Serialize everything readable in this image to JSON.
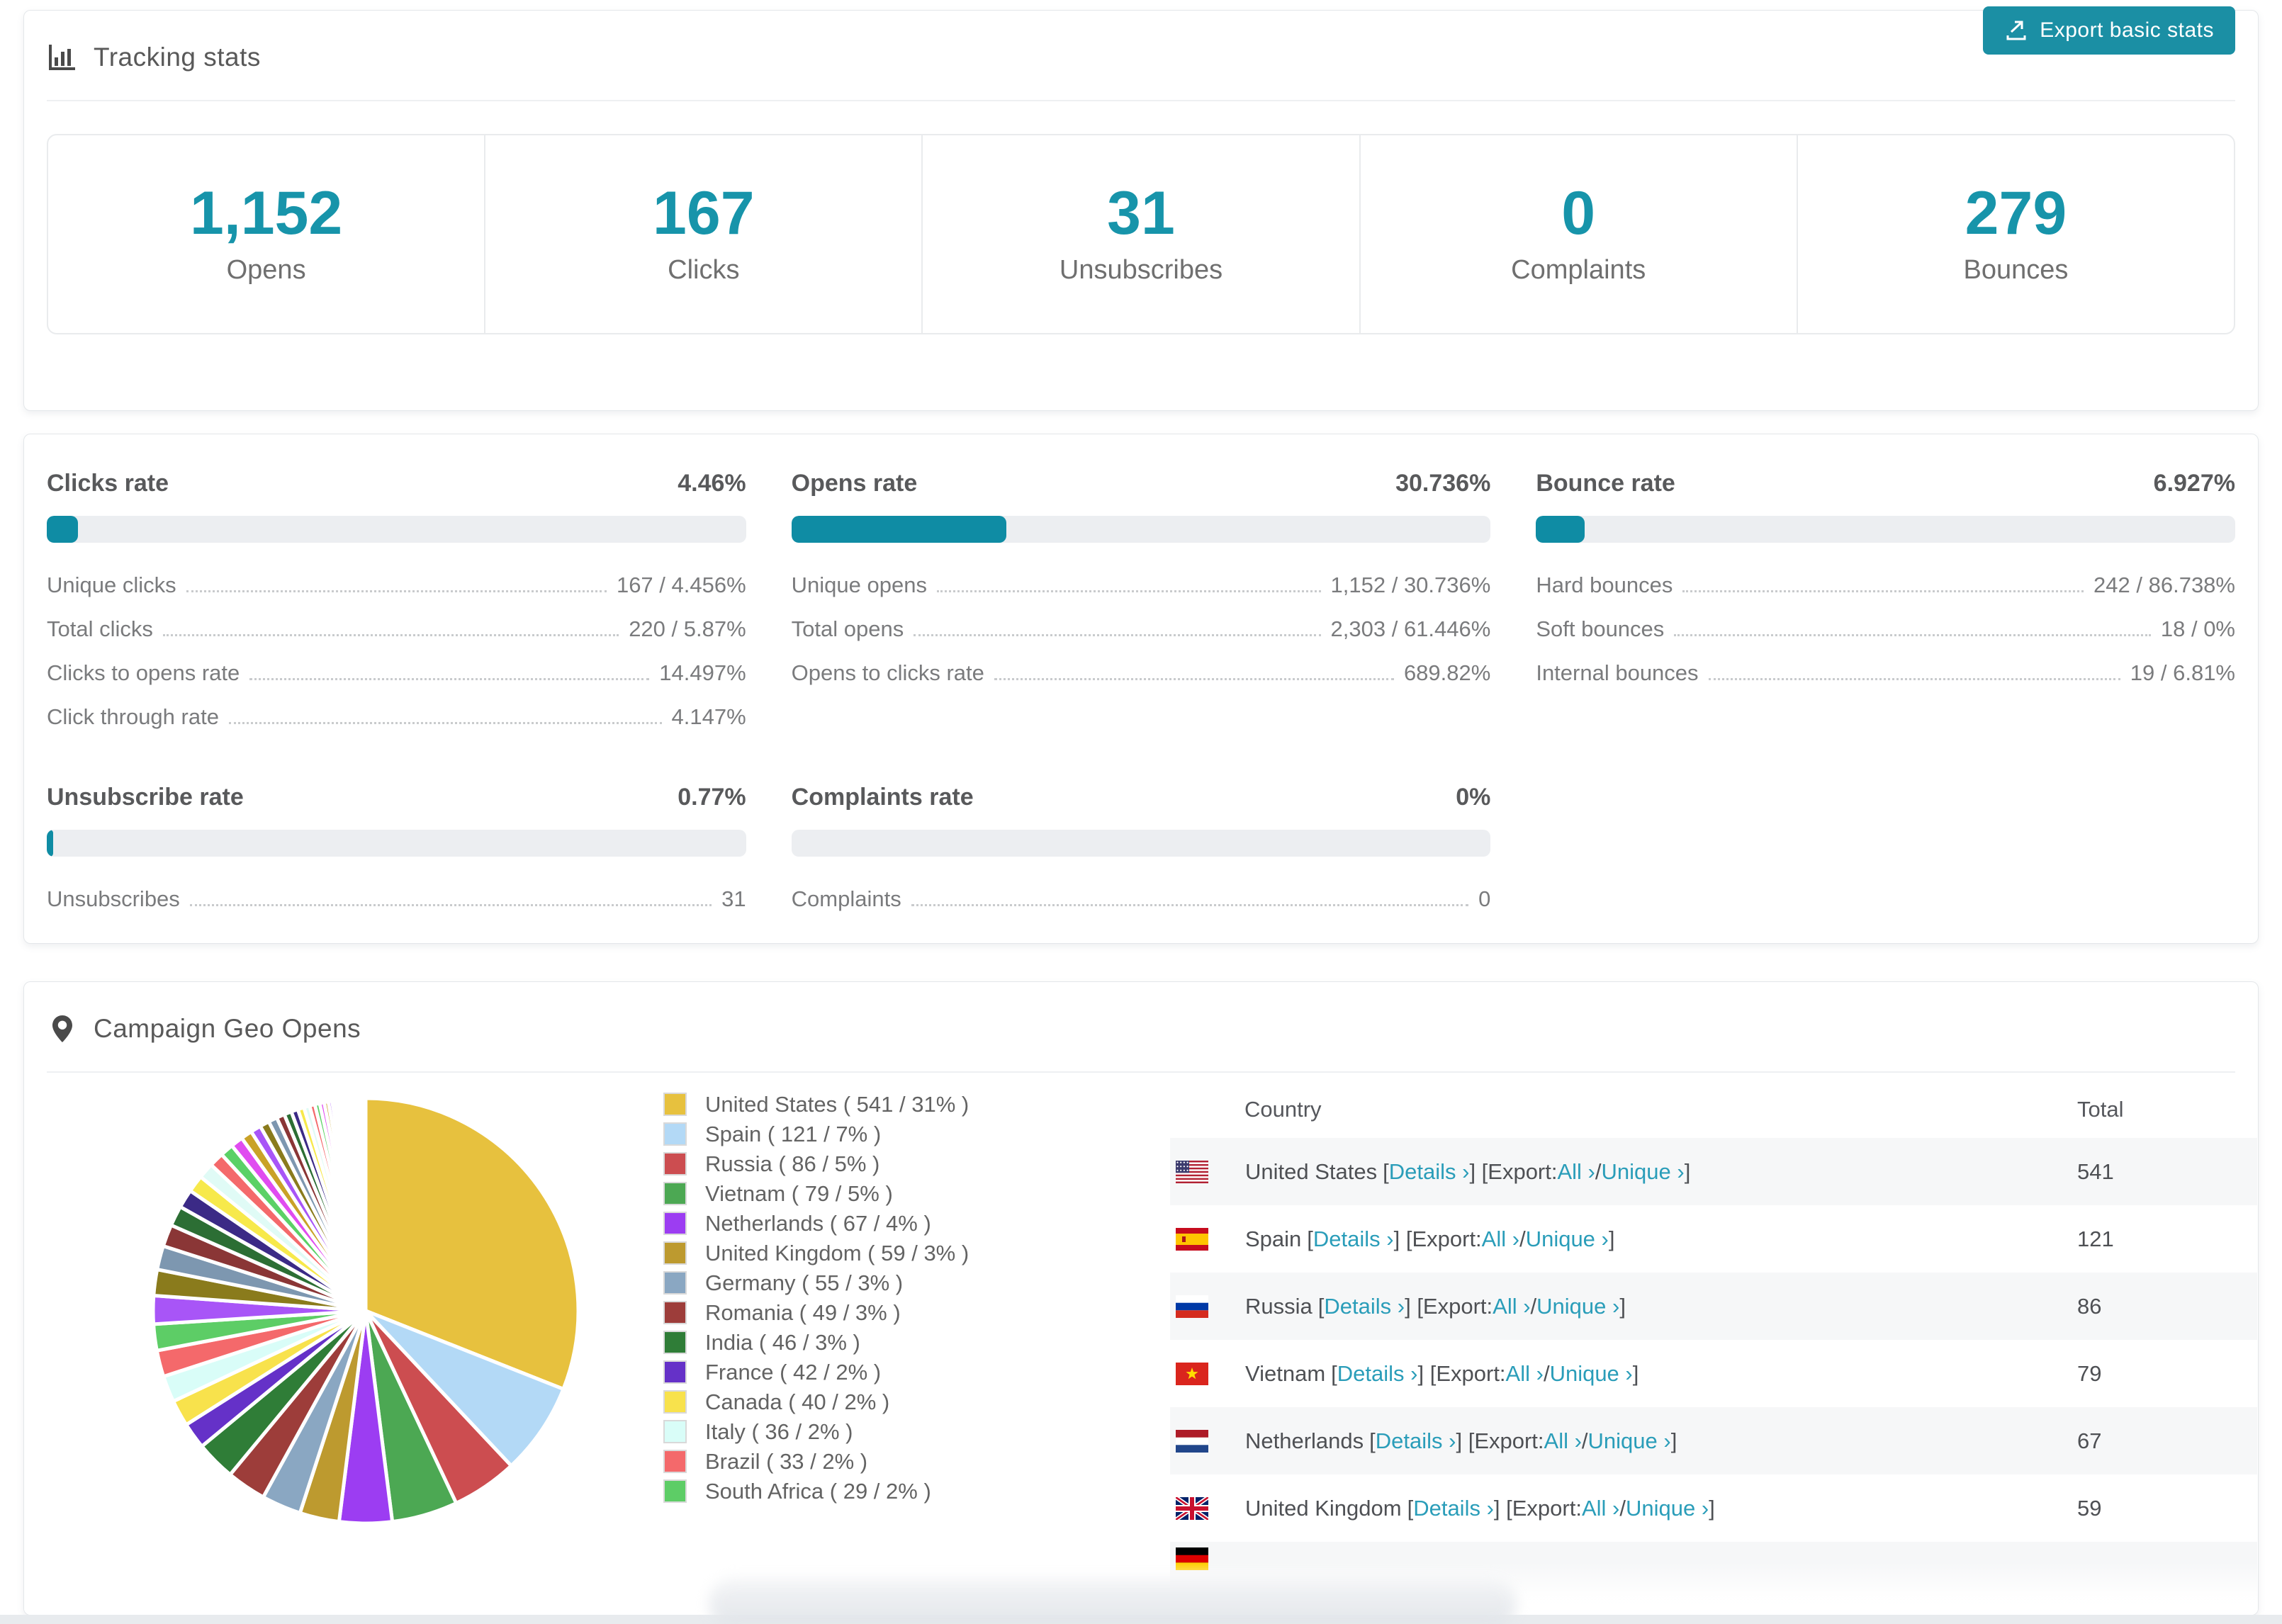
{
  "accent_color": "#1794aa",
  "link_color": "#2a9db9",
  "tracking": {
    "title": "Tracking stats",
    "export_button_label": "Export basic stats",
    "stats": [
      {
        "value": "1,152",
        "label": "Opens"
      },
      {
        "value": "167",
        "label": "Clicks"
      },
      {
        "value": "31",
        "label": "Unsubscribes"
      },
      {
        "value": "0",
        "label": "Complaints"
      },
      {
        "value": "279",
        "label": "Bounces"
      }
    ]
  },
  "rates": [
    {
      "title": "Clicks rate",
      "pct_label": "4.46%",
      "fill_pct": 4.46,
      "rows": [
        [
          "Unique clicks",
          "167 / 4.456%"
        ],
        [
          "Total clicks",
          "220 / 5.87%"
        ],
        [
          "Clicks to opens rate",
          "14.497%"
        ],
        [
          "Click through rate",
          "4.147%"
        ]
      ]
    },
    {
      "title": "Opens rate",
      "pct_label": "30.736%",
      "fill_pct": 30.736,
      "rows": [
        [
          "Unique opens",
          "1,152 / 30.736%"
        ],
        [
          "Total opens",
          "2,303 / 61.446%"
        ],
        [
          "Opens to clicks rate",
          "689.82%"
        ]
      ]
    },
    {
      "title": "Bounce rate",
      "pct_label": "6.927%",
      "fill_pct": 6.927,
      "rows": [
        [
          "Hard bounces",
          "242 / 86.738%"
        ],
        [
          "Soft bounces",
          "18 / 0%"
        ],
        [
          "Internal bounces",
          "19 / 6.81%"
        ]
      ]
    },
    {
      "title": "Unsubscribe rate",
      "pct_label": "0.77%",
      "fill_pct": 0.77,
      "rows": [
        [
          "Unsubscribes",
          "31"
        ]
      ]
    },
    {
      "title": "Complaints rate",
      "pct_label": "0%",
      "fill_pct": 0,
      "rows": [
        [
          "Complaints",
          "0"
        ]
      ]
    }
  ],
  "geo": {
    "title": "Campaign Geo Opens",
    "chart_data": {
      "type": "pie",
      "title": "Campaign Geo Opens",
      "legend_position": "right",
      "series": [
        {
          "name": "United States",
          "value": 541,
          "pct": 31,
          "color": "#e7c13e",
          "flag": "us"
        },
        {
          "name": "Spain",
          "value": 121,
          "pct": 7,
          "color": "#b3d9f6",
          "flag": "es"
        },
        {
          "name": "Russia",
          "value": 86,
          "pct": 5,
          "color": "#cc4d50",
          "flag": "ru"
        },
        {
          "name": "Vietnam",
          "value": 79,
          "pct": 5,
          "color": "#4ca853",
          "flag": "vn"
        },
        {
          "name": "Netherlands",
          "value": 67,
          "pct": 4,
          "color": "#9c3df2",
          "flag": "nl"
        },
        {
          "name": "United Kingdom",
          "value": 59,
          "pct": 3,
          "color": "#bd9a2f",
          "flag": "gb"
        },
        {
          "name": "Germany",
          "value": 55,
          "pct": 3,
          "color": "#8aa7c2",
          "flag": "de"
        },
        {
          "name": "Romania",
          "value": 49,
          "pct": 3,
          "color": "#9d3d3a",
          "flag": "ro"
        },
        {
          "name": "India",
          "value": 46,
          "pct": 3,
          "color": "#2f7d37",
          "flag": "in"
        },
        {
          "name": "France",
          "value": 42,
          "pct": 2,
          "color": "#6531c8",
          "flag": "fr"
        },
        {
          "name": "Canada",
          "value": 40,
          "pct": 2,
          "color": "#f8e24c",
          "flag": "ca"
        },
        {
          "name": "Italy",
          "value": 36,
          "pct": 2,
          "color": "#d9fdf8",
          "flag": "it"
        },
        {
          "name": "Brazil",
          "value": 33,
          "pct": 2,
          "color": "#f4696b",
          "flag": "br"
        },
        {
          "name": "South Africa",
          "value": 29,
          "pct": 2,
          "color": "#5dcd66",
          "flag": "za"
        }
      ],
      "others_tail": {
        "total_pct": 26,
        "count": 42,
        "decay": 0.92,
        "colors": [
          "#a855f7",
          "#8a7b1c",
          "#7d97b0",
          "#8a3636",
          "#2c6e34",
          "#3b2a86",
          "#f7e94b",
          "#e0fbf6",
          "#f4696b",
          "#5bd166",
          "#e04cf0",
          "#c9a227"
        ]
      }
    },
    "legend_format": {
      "open": " ( ",
      "sep": " / ",
      "close": "% )"
    },
    "table": {
      "headers": {
        "country": "Country",
        "total": "Total"
      },
      "segments": {
        "s1": " [",
        "details": "Details ›",
        "s2": "] [Export: ",
        "all": "All ›",
        "s3": " / ",
        "unique": "Unique ›",
        "s4": "]"
      },
      "rows": [
        {
          "country": "United States",
          "total": "541",
          "flag": "us"
        },
        {
          "country": "Spain",
          "total": "121",
          "flag": "es"
        },
        {
          "country": "Russia",
          "total": "86",
          "flag": "ru"
        },
        {
          "country": "Vietnam",
          "total": "79",
          "flag": "vn"
        },
        {
          "country": "Netherlands",
          "total": "67",
          "flag": "nl"
        },
        {
          "country": "United Kingdom",
          "total": "59",
          "flag": "gb"
        }
      ],
      "partial_row_flag": "de"
    }
  }
}
